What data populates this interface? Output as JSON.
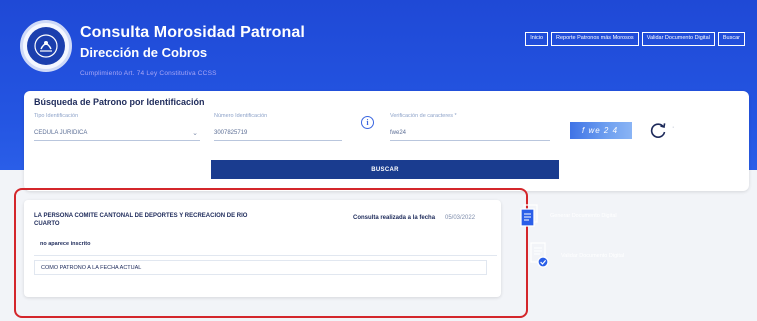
{
  "header": {
    "title": "Consulta Morosidad Patronal",
    "subtitle": "Dirección de Cobros",
    "law_note": "Cumplimiento Art. 74 Ley Constitutiva CCSS",
    "background_color": "#2455e2"
  },
  "nav": {
    "items": [
      {
        "label": "Inicio"
      },
      {
        "label": "Reporte Patronos más Morosos"
      },
      {
        "label": "Validar Documento Digital"
      },
      {
        "label": "Buscar"
      }
    ]
  },
  "search": {
    "title": "Búsqueda de Patrono por Identificación",
    "tipo_label": "Tipo Identificación",
    "tipo_value": "CEDULA JURIDICA",
    "numero_label": "Número Identificación",
    "numero_value": "3007825719",
    "captcha_label": "Verificación de caracteres *",
    "captcha_input_value": "fwe24",
    "captcha_image_text": "f we 2 4",
    "button_label": "BUSCAR"
  },
  "result": {
    "patrono_name": "LA PERSONA COMITE CANTONAL DE DEPORTES Y RECREACION DE RIO CUARTO",
    "consult_label": "Consulta realizada a la fecha",
    "consult_date": "05/03/2022",
    "status_short": "no aparece inscrito",
    "status_long": "COMO PATRONO A LA FECHA ACTUAL"
  },
  "side_actions": {
    "generate_label": "Generar Documento Digital",
    "validate_label": "Validar Documento Digital"
  },
  "colors": {
    "accent": "#1a3c8f",
    "highlight": "#d4262b"
  }
}
